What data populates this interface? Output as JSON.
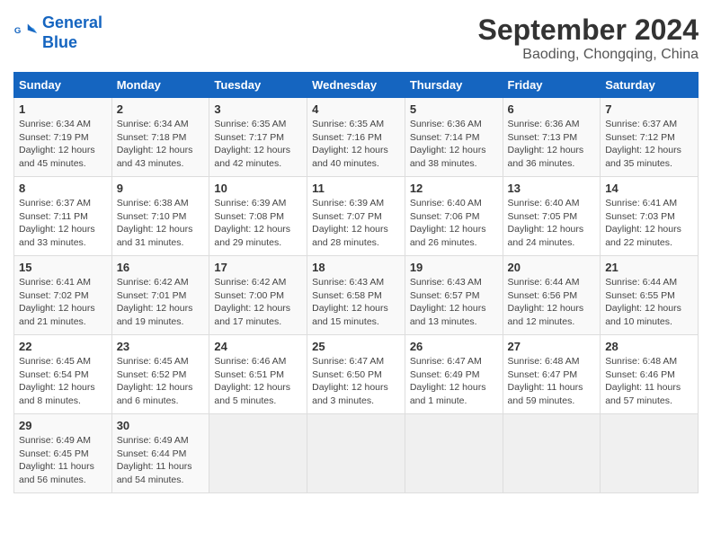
{
  "header": {
    "logo_line1": "General",
    "logo_line2": "Blue",
    "month": "September 2024",
    "location": "Baoding, Chongqing, China"
  },
  "weekdays": [
    "Sunday",
    "Monday",
    "Tuesday",
    "Wednesday",
    "Thursday",
    "Friday",
    "Saturday"
  ],
  "weeks": [
    [
      {
        "day": "1",
        "sunrise": "6:34 AM",
        "sunset": "7:19 PM",
        "daylight": "12 hours and 45 minutes."
      },
      {
        "day": "2",
        "sunrise": "6:34 AM",
        "sunset": "7:18 PM",
        "daylight": "12 hours and 43 minutes."
      },
      {
        "day": "3",
        "sunrise": "6:35 AM",
        "sunset": "7:17 PM",
        "daylight": "12 hours and 42 minutes."
      },
      {
        "day": "4",
        "sunrise": "6:35 AM",
        "sunset": "7:16 PM",
        "daylight": "12 hours and 40 minutes."
      },
      {
        "day": "5",
        "sunrise": "6:36 AM",
        "sunset": "7:14 PM",
        "daylight": "12 hours and 38 minutes."
      },
      {
        "day": "6",
        "sunrise": "6:36 AM",
        "sunset": "7:13 PM",
        "daylight": "12 hours and 36 minutes."
      },
      {
        "day": "7",
        "sunrise": "6:37 AM",
        "sunset": "7:12 PM",
        "daylight": "12 hours and 35 minutes."
      }
    ],
    [
      {
        "day": "8",
        "sunrise": "6:37 AM",
        "sunset": "7:11 PM",
        "daylight": "12 hours and 33 minutes."
      },
      {
        "day": "9",
        "sunrise": "6:38 AM",
        "sunset": "7:10 PM",
        "daylight": "12 hours and 31 minutes."
      },
      {
        "day": "10",
        "sunrise": "6:39 AM",
        "sunset": "7:08 PM",
        "daylight": "12 hours and 29 minutes."
      },
      {
        "day": "11",
        "sunrise": "6:39 AM",
        "sunset": "7:07 PM",
        "daylight": "12 hours and 28 minutes."
      },
      {
        "day": "12",
        "sunrise": "6:40 AM",
        "sunset": "7:06 PM",
        "daylight": "12 hours and 26 minutes."
      },
      {
        "day": "13",
        "sunrise": "6:40 AM",
        "sunset": "7:05 PM",
        "daylight": "12 hours and 24 minutes."
      },
      {
        "day": "14",
        "sunrise": "6:41 AM",
        "sunset": "7:03 PM",
        "daylight": "12 hours and 22 minutes."
      }
    ],
    [
      {
        "day": "15",
        "sunrise": "6:41 AM",
        "sunset": "7:02 PM",
        "daylight": "12 hours and 21 minutes."
      },
      {
        "day": "16",
        "sunrise": "6:42 AM",
        "sunset": "7:01 PM",
        "daylight": "12 hours and 19 minutes."
      },
      {
        "day": "17",
        "sunrise": "6:42 AM",
        "sunset": "7:00 PM",
        "daylight": "12 hours and 17 minutes."
      },
      {
        "day": "18",
        "sunrise": "6:43 AM",
        "sunset": "6:58 PM",
        "daylight": "12 hours and 15 minutes."
      },
      {
        "day": "19",
        "sunrise": "6:43 AM",
        "sunset": "6:57 PM",
        "daylight": "12 hours and 13 minutes."
      },
      {
        "day": "20",
        "sunrise": "6:44 AM",
        "sunset": "6:56 PM",
        "daylight": "12 hours and 12 minutes."
      },
      {
        "day": "21",
        "sunrise": "6:44 AM",
        "sunset": "6:55 PM",
        "daylight": "12 hours and 10 minutes."
      }
    ],
    [
      {
        "day": "22",
        "sunrise": "6:45 AM",
        "sunset": "6:54 PM",
        "daylight": "12 hours and 8 minutes."
      },
      {
        "day": "23",
        "sunrise": "6:45 AM",
        "sunset": "6:52 PM",
        "daylight": "12 hours and 6 minutes."
      },
      {
        "day": "24",
        "sunrise": "6:46 AM",
        "sunset": "6:51 PM",
        "daylight": "12 hours and 5 minutes."
      },
      {
        "day": "25",
        "sunrise": "6:47 AM",
        "sunset": "6:50 PM",
        "daylight": "12 hours and 3 minutes."
      },
      {
        "day": "26",
        "sunrise": "6:47 AM",
        "sunset": "6:49 PM",
        "daylight": "12 hours and 1 minute."
      },
      {
        "day": "27",
        "sunrise": "6:48 AM",
        "sunset": "6:47 PM",
        "daylight": "11 hours and 59 minutes."
      },
      {
        "day": "28",
        "sunrise": "6:48 AM",
        "sunset": "6:46 PM",
        "daylight": "11 hours and 57 minutes."
      }
    ],
    [
      {
        "day": "29",
        "sunrise": "6:49 AM",
        "sunset": "6:45 PM",
        "daylight": "11 hours and 56 minutes."
      },
      {
        "day": "30",
        "sunrise": "6:49 AM",
        "sunset": "6:44 PM",
        "daylight": "11 hours and 54 minutes."
      },
      null,
      null,
      null,
      null,
      null
    ]
  ]
}
